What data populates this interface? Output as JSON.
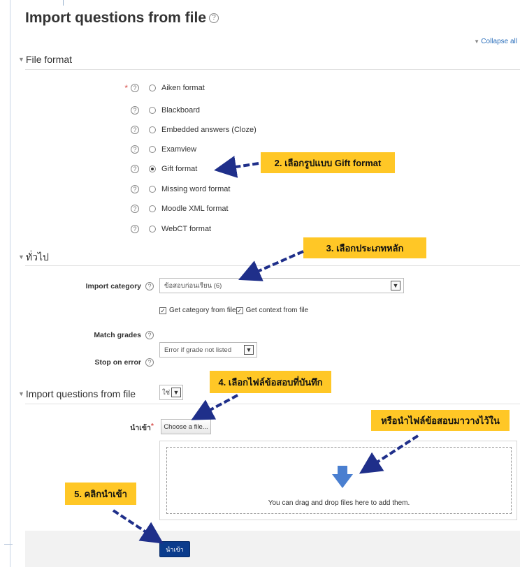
{
  "page": {
    "title": "Import questions from file",
    "title_help": "?",
    "collapse_all": "Collapse all"
  },
  "sections": {
    "file_format": "File format",
    "general": "ทั่วไป",
    "import_file": "Import questions from file"
  },
  "formats": [
    {
      "label": "Aiken format",
      "required": true,
      "checked": false
    },
    {
      "label": "Blackboard",
      "required": false,
      "checked": false
    },
    {
      "label": "Embedded answers (Cloze)",
      "required": false,
      "checked": false
    },
    {
      "label": "Examview",
      "required": false,
      "checked": false
    },
    {
      "label": "Gift format",
      "required": false,
      "checked": true
    },
    {
      "label": "Missing word format",
      "required": false,
      "checked": false
    },
    {
      "label": "Moodle XML format",
      "required": false,
      "checked": false
    },
    {
      "label": "WebCT format",
      "required": false,
      "checked": false
    }
  ],
  "general": {
    "import_category_label": "Import category",
    "import_category_value": "ข้อสอบก่อนเรียน (6)",
    "get_category_label": "Get category from file",
    "get_context_label": "Get context from file",
    "match_grades_label": "Match grades",
    "match_grades_value": "Error if grade not listed",
    "stop_on_error_label": "Stop on error",
    "stop_on_error_value": "ใช่"
  },
  "import_file": {
    "file_label": "นำเข้า",
    "required_mark": "*",
    "choose_file": "Choose a file...",
    "drop_text": "You can drag and drop files here to add them."
  },
  "submit": "นำเข้า",
  "callouts": {
    "c2": "2. เลือกรูปแบบ Gift format",
    "c3": "3. เลือกประเภทหลัก",
    "c4": "4. เลือกไฟล์ข้อสอบที่บันทึก",
    "c_drop": "หรือนำไฟล์ข้อสอบมาวางไว้ใน",
    "c5": "5. คลิกนำเข้า"
  },
  "colors": {
    "callout_bg": "#ffc726",
    "arrow": "#1f2f8a",
    "submit_bg": "#0b3c8c",
    "link": "#2a6ebb",
    "required": "#d9534f",
    "drop_arrow": "#4a7fd0"
  },
  "icons": {
    "help": "question-circle-icon",
    "collapse_toggle": "triangle-down-icon",
    "select_arrow": "chevron-down-icon",
    "drop_arrow": "arrow-down-icon",
    "annotation_arrow": "dashed-arrow-icon"
  }
}
